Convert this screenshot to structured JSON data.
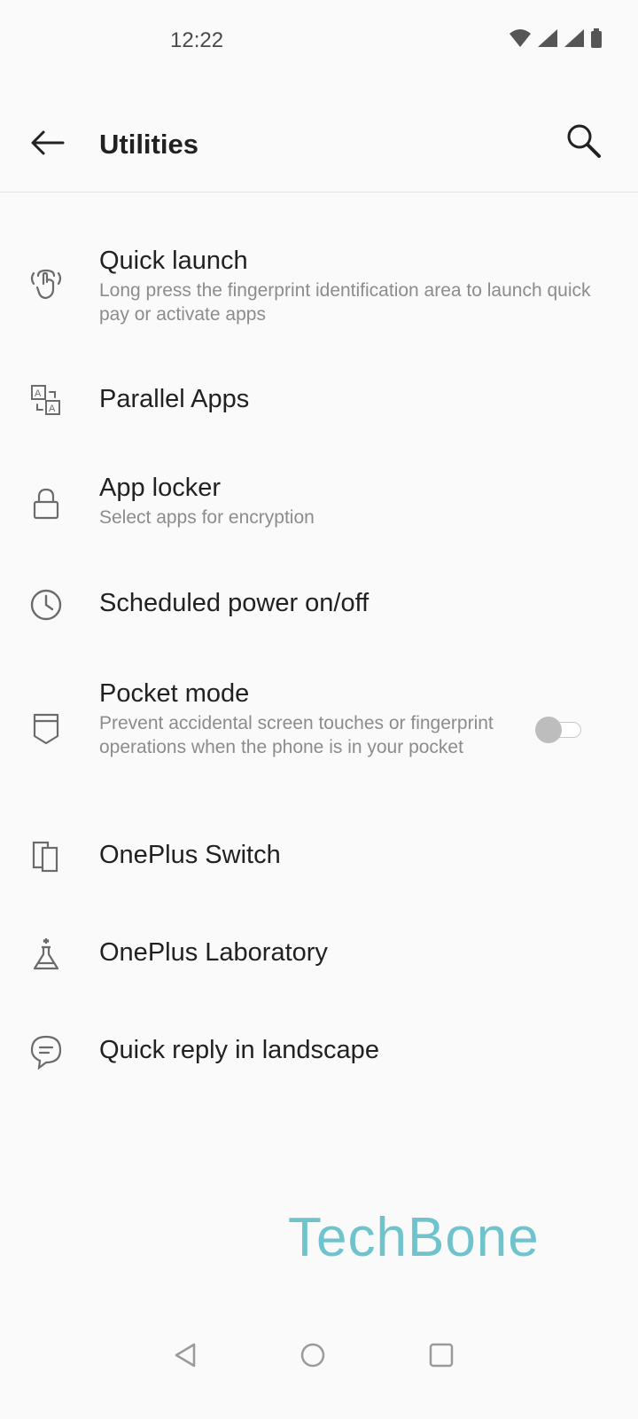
{
  "status_bar": {
    "time": "12:22"
  },
  "app_bar": {
    "title": "Utilities"
  },
  "items": [
    {
      "title": "Quick launch",
      "subtitle": "Long press the fingerprint identification area to launch quick pay or activate apps",
      "icon": "fingerprint-hand-icon"
    },
    {
      "title": "Parallel Apps",
      "icon": "parallel-apps-icon"
    },
    {
      "title": "App locker",
      "subtitle": "Select apps for encryption",
      "icon": "lock-icon"
    },
    {
      "title": "Scheduled power on/off",
      "icon": "clock-icon"
    },
    {
      "title": "Pocket mode",
      "subtitle": "Prevent accidental screen touches or fingerprint operations when the phone is in your pocket",
      "icon": "pocket-icon",
      "toggle_on": false
    },
    {
      "title": "OnePlus Switch",
      "icon": "phone-switch-icon"
    },
    {
      "title": "OnePlus Laboratory",
      "icon": "flask-icon"
    },
    {
      "title": "Quick reply in landscape",
      "icon": "chat-bubble-icon"
    }
  ],
  "watermark": "TechBone",
  "colors": {
    "background": "#fafafa",
    "text": "#212121",
    "subtext": "#8c8c8c",
    "watermark": "#6fc3cc"
  }
}
